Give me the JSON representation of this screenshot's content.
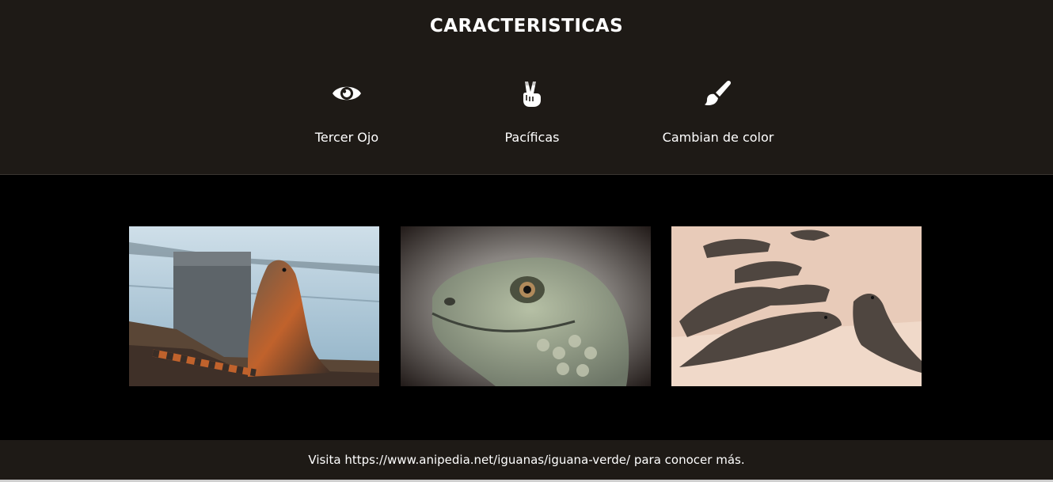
{
  "features": {
    "title": "CARACTERISTICAS",
    "items": [
      {
        "icon": "eye-icon",
        "label": "Tercer Ojo"
      },
      {
        "icon": "peace-hand-icon",
        "label": "Pacíficas"
      },
      {
        "icon": "paint-brush-icon",
        "label": "Cambian de color"
      }
    ]
  },
  "gallery": {
    "images": [
      {
        "name": "iguana-on-rocks-photo"
      },
      {
        "name": "iguana-head-closeup-photo"
      },
      {
        "name": "iguanas-on-sand-photo"
      }
    ]
  },
  "footer": {
    "text": "Visita https://www.anipedia.net/iguanas/iguana-verde/ para conocer más."
  }
}
